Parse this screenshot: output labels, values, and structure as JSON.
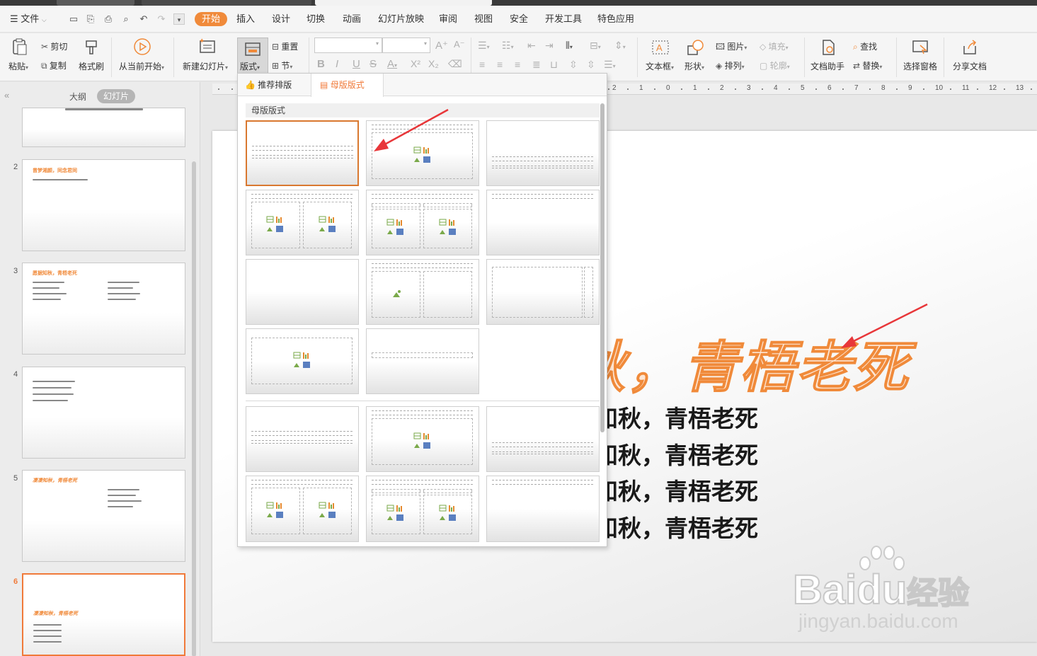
{
  "menu": {
    "file": "文件",
    "items": [
      "开始",
      "插入",
      "设计",
      "切换",
      "动画",
      "幻灯片放映",
      "审阅",
      "视图",
      "安全",
      "开发工具",
      "特色应用"
    ],
    "active": "开始"
  },
  "ribbon": {
    "paste": "粘贴",
    "cut": "剪切",
    "copy": "复制",
    "format_painter": "格式刷",
    "from_current": "从当前开始",
    "new_slide": "新建幻灯片",
    "layout": "版式",
    "reset": "重置",
    "section": "节",
    "textbox": "文本框",
    "shape": "形状",
    "picture": "图片",
    "arrange": "排列",
    "fill": "填充",
    "outline": "轮廓",
    "doc_assistant": "文档助手",
    "find": "查找",
    "replace": "替换",
    "selection_pane": "选择窗格",
    "share_doc": "分享文档"
  },
  "left_panel": {
    "outline_tab": "大纲",
    "slides_tab": "幻灯片",
    "slide_numbers": [
      "2",
      "3",
      "4",
      "5",
      "6"
    ]
  },
  "thumbs": {
    "s2_title": "曾梦湘颜，同念君同",
    "s3_title": "愿据知秋，青梧老死",
    "s5_title": "凄凄知秋，青梧老死",
    "s6_title": "凄凄知秋，青梧老死"
  },
  "ruler": {
    "labels": [
      "2",
      "1",
      "0",
      "1",
      "2",
      "3",
      "4",
      "5",
      "6",
      "7",
      "8",
      "9",
      "10",
      "11",
      "12",
      "13"
    ]
  },
  "dropdown": {
    "tab_recommended": "推荐排版",
    "tab_master": "母版版式",
    "section_title": "母版版式"
  },
  "slide": {
    "title": "秋，青梧老死",
    "lines": [
      "知秋，青梧老死",
      "知秋，青梧老死",
      "知秋，青梧老死",
      "知秋，青梧老死"
    ]
  },
  "watermark": {
    "brand": "Bai",
    "brand2": "du",
    "cn": "经验",
    "url": "jingyan.baidu.com"
  },
  "colors": {
    "accent": "#f08a3a",
    "arrow": "#e8373a"
  }
}
